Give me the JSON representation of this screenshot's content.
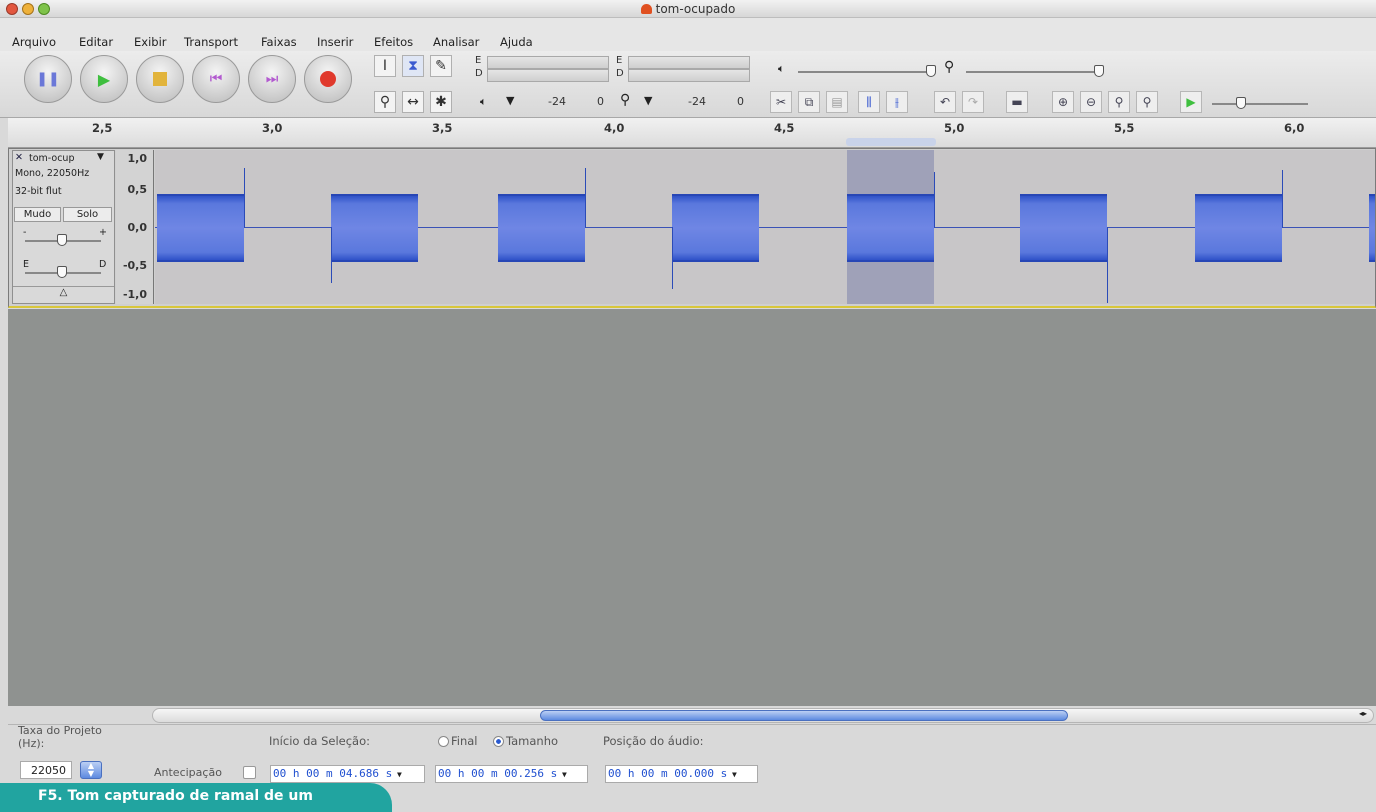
{
  "window": {
    "title": "tom-ocupado"
  },
  "menu": [
    "Arquivo",
    "Editar",
    "Exibir",
    "Transport",
    "Faixas",
    "Inserir",
    "Efeitos",
    "Analisar",
    "Ajuda"
  ],
  "meters": {
    "left_channel": "E",
    "right_channel": "D",
    "playback_min": "-24",
    "playback_max": "0",
    "record_min": "-24",
    "record_max": "0"
  },
  "ruler": {
    "ticks": [
      "2,5",
      "3,0",
      "3,5",
      "4,0",
      "4,5",
      "5,0",
      "5,5",
      "6,0"
    ]
  },
  "track": {
    "name": "tom-ocup",
    "format": "Mono, 22050Hz",
    "bitdepth": "32-bit flut",
    "mute": "Mudo",
    "solo": "Solo",
    "gain_minus": "-",
    "gain_plus": "+",
    "pan_left": "E",
    "pan_right": "D",
    "collapse": "△",
    "scale": [
      "1,0",
      "0,5",
      "0,0",
      "-0,5",
      "-1,0"
    ]
  },
  "selection_bar": {
    "project_rate_label": "Taxa do Projeto (Hz):",
    "project_rate_value": "22050",
    "snap_label": "Antecipação",
    "selection_start_label": "Início da Seleção:",
    "end_option": "Final",
    "length_option": "Tamanho",
    "audio_position_label": "Posição do áudio:",
    "selection_start_value": "00 h 00 m 04.686 s",
    "selection_length_value": "00 h 00 m 00.256 s",
    "audio_position_value": "00 h 00 m 00.000 s"
  },
  "caption": "F5. Tom capturado de ramal de um",
  "colors": {
    "waveform": "#3a5ad0",
    "caption_bg": "#21a4a0",
    "selection": "#9fa1b8"
  }
}
